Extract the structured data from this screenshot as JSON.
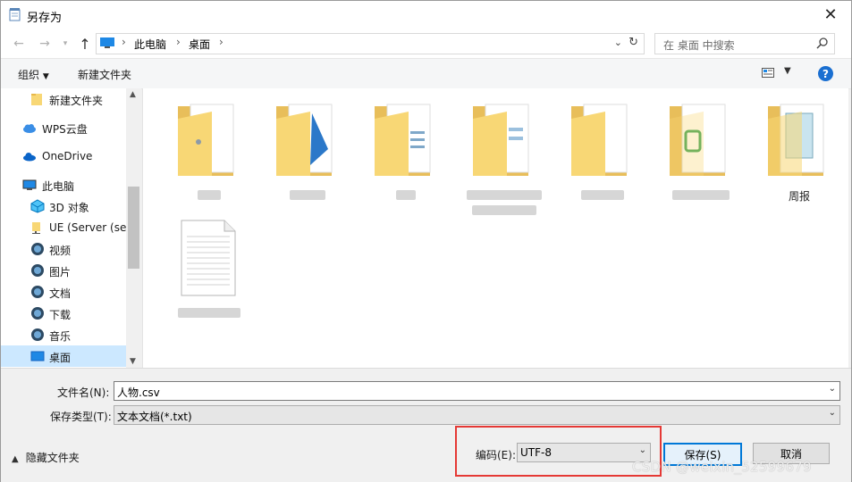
{
  "window": {
    "title": "另存为"
  },
  "address": {
    "crumbs": [
      "此电脑",
      "桌面"
    ],
    "search_placeholder": "在 桌面 中搜索"
  },
  "toolbar": {
    "organize": "组织",
    "new_folder": "新建文件夹"
  },
  "nav": {
    "items": [
      {
        "label": "新建文件夹",
        "icon": "folder-icon"
      },
      {
        "label": "WPS云盘",
        "icon": "cloud-icon"
      },
      {
        "label": "OneDrive",
        "icon": "onedrive-icon"
      },
      {
        "label": "此电脑",
        "icon": "computer-icon"
      },
      {
        "label": "3D 对象",
        "icon": "cube-3d-icon"
      },
      {
        "label": "UE (Server (ser",
        "icon": "network-folder-icon"
      },
      {
        "label": "视频",
        "icon": "video-icon"
      },
      {
        "label": "图片",
        "icon": "picture-icon"
      },
      {
        "label": "文档",
        "icon": "document-icon"
      },
      {
        "label": "下载",
        "icon": "download-icon"
      },
      {
        "label": "音乐",
        "icon": "music-icon"
      },
      {
        "label": "桌面",
        "icon": "desktop-icon"
      }
    ]
  },
  "files": [
    {
      "type": "folder",
      "label": ""
    },
    {
      "type": "folder",
      "label": ""
    },
    {
      "type": "folder",
      "label": ""
    },
    {
      "type": "folder",
      "label": ""
    },
    {
      "type": "folder",
      "label": ""
    },
    {
      "type": "folder",
      "label": ""
    },
    {
      "type": "folder",
      "label": "周报"
    },
    {
      "type": "document",
      "label": ""
    }
  ],
  "form": {
    "filename_label": "文件名(N):",
    "filename_value": "人物.csv",
    "filetype_label": "保存类型(T):",
    "filetype_value": "文本文档(*.txt)",
    "encoding_label": "编码(E):",
    "encoding_value": "UTF-8",
    "hide_folders": "隐藏文件夹",
    "save": "保存(S)",
    "cancel": "取消"
  },
  "watermark": "CSDN @weixin_52599679",
  "colors": {
    "accent": "#0078d7",
    "highlight_box": "#e53935",
    "selected": "#cce8ff"
  }
}
